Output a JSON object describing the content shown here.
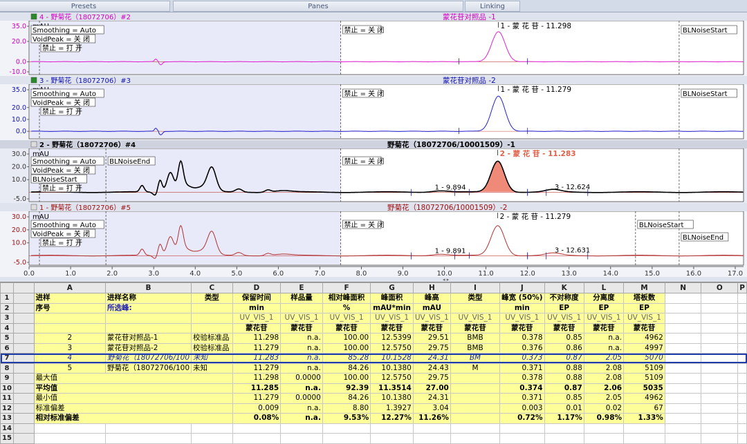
{
  "top_tabs": [
    {
      "label": "Presets"
    },
    {
      "label": "Panes"
    },
    {
      "label": "Linking"
    }
  ],
  "xaxis": {
    "min": 0,
    "max": 17.2,
    "ticks": [
      "0.0",
      "1.0",
      "2.0",
      "3.0",
      "4.0",
      "5.0",
      "6.0",
      "7.0",
      "8.0",
      "9.0",
      "10.0",
      "11.0",
      "12.0",
      "13.0",
      "14.0",
      "15.0",
      "16.0",
      "17.0"
    ]
  },
  "panels": [
    {
      "header": "4 - 野菊花（18072706）#2",
      "title": "蒙花苷对照品 -1",
      "color": "#e020d8",
      "headcolor": "#d000c0",
      "unit": "mAU",
      "yticks": [
        "35.0",
        "20.0",
        "0.0",
        "-10.0"
      ],
      "ymin": -10,
      "ymax": 35,
      "selected": false,
      "labels": [
        "Smoothing = Auto",
        "VoidPeak = 关 闭",
        "禁止 = 打 开",
        "禁止 = 关 闭",
        "BLNoiseStart"
      ],
      "peaks": [
        "1 - 蒙 花 苷 - 11.298"
      ],
      "fill": false
    },
    {
      "header": "3 - 野菊花（18072706）#3",
      "title": "蒙花苷对照品 -2",
      "color": "#2020d0",
      "headcolor": "#1010b0",
      "unit": "mAU",
      "yticks": [
        "35.0",
        "20.0",
        "10.0",
        "0.0"
      ],
      "ymin": -4,
      "ymax": 35,
      "selected": false,
      "labels": [
        "Smoothing = Auto",
        "VoidPeak = 关 闭",
        "禁止 = 打 开",
        "禁止 = 关 闭",
        "BLNoiseStart"
      ],
      "peaks": [
        "1 - 蒙 花 苷 - 11.279"
      ],
      "fill": false
    },
    {
      "header": "2 - 野菊花（18072706）#4",
      "title": "野菊花（18072706/10001509）-1",
      "color": "#000000",
      "headcolor": "#000000",
      "unit": "mAU",
      "yticks": [
        "30.0",
        "20.0",
        "10.0",
        "-5.0"
      ],
      "ymin": -5,
      "ymax": 30,
      "selected": true,
      "labels": [
        "Smoothing = Auto",
        "VoidPeak = 关 闭",
        "BLNoiseStart",
        "禁止 = 打 开",
        "BLNoiseEnd",
        "禁止 = 关 闭"
      ],
      "peaks": [
        "2 - 蒙 花 苷 - 11.283",
        "1 - 9.894",
        "3 - 12.624"
      ],
      "fill": true
    },
    {
      "header": "1 - 野菊花（18072706）#5",
      "title": "野菊花（18072706/10001509）-2",
      "color": "#b03030",
      "headcolor": "#a01010",
      "unit": "mAU",
      "yticks": [
        "30.0",
        "20.0",
        "10.0",
        "-5.0"
      ],
      "ymin": -5,
      "ymax": 30,
      "selected": false,
      "labels": [
        "Smoothing = Auto",
        "VoidPeak = 关 闭",
        "禁止 = 打 开",
        "禁止 = 关 闭",
        "BLNoiseStart",
        "BLNoiseEnd"
      ],
      "peaks": [
        "2 - 蒙 花 苷 - 11.279",
        "1 - 9.891",
        "3 - 12.631"
      ],
      "fill": false
    }
  ],
  "grid": {
    "columns": [
      "A",
      "B",
      "C",
      "D",
      "E",
      "F",
      "G",
      "H",
      "I",
      "J",
      "K",
      "L",
      "M",
      "N",
      "O",
      "P"
    ],
    "header_rows": [
      [
        "进样",
        "进样名称",
        "类型",
        "保留时间",
        "样品量",
        "相对峰面积",
        "峰面积",
        "峰高",
        "类型",
        "峰宽 (50%)",
        "不对称度",
        "分离度",
        "塔板数"
      ],
      [
        "序号",
        "所选峰:",
        "",
        "min",
        "",
        "%",
        "mAU*min",
        "mAU",
        "",
        "min",
        "EP",
        "EP",
        "EP"
      ],
      [
        "",
        "",
        "",
        "UV_VIS_1",
        "UV_VIS_1",
        "UV_VIS_1",
        "UV_VIS_1",
        "UV_VIS_1",
        "UV_VIS_1",
        "UV_VIS_1",
        "UV_VIS_1",
        "UV_VIS_1",
        "UV_VIS_1"
      ],
      [
        "",
        "",
        "",
        "蒙花苷",
        "蒙花苷",
        "蒙花苷",
        "蒙花苷",
        "蒙花苷",
        "蒙花苷",
        "蒙花苷",
        "蒙花苷",
        "蒙花苷",
        "蒙花苷"
      ]
    ],
    "data_rows": [
      [
        "2",
        "蒙花苷对照品-1",
        "校验标准品",
        "11.298",
        "n.a.",
        "100.00",
        "12.5399",
        "29.51",
        "BMB",
        "0.378",
        "0.85",
        "n.a.",
        "4962"
      ],
      [
        "3",
        "蒙花苷对照品-2",
        "校验标准品",
        "11.279",
        "n.a.",
        "100.00",
        "12.5750",
        "29.75",
        "BMB",
        "0.376",
        "0.86",
        "n.a.",
        "4997"
      ],
      [
        "4",
        "野菊花（18072706/100",
        "未知",
        "11.283",
        "n.a.",
        "85.28",
        "10.1528",
        "24.31",
        "BM",
        "0.373",
        "0.87",
        "2.05",
        "5070"
      ],
      [
        "5",
        "野菊花（18072706/100",
        "未知",
        "11.279",
        "n.a.",
        "84.26",
        "10.1380",
        "24.43",
        "M",
        "0.371",
        "0.88",
        "2.08",
        "5109"
      ]
    ],
    "stat_rows": [
      [
        "最大值",
        "11.298",
        "0.0000",
        "100.00",
        "12.5750",
        "29.75",
        "",
        "0.378",
        "0.88",
        "2.08",
        "5109"
      ],
      [
        "平均值",
        "11.285",
        "n.a.",
        "92.39",
        "11.3514",
        "27.00",
        "",
        "0.374",
        "0.87",
        "2.06",
        "5035"
      ],
      [
        "最小值",
        "11.279",
        "0.0000",
        "84.26",
        "10.1380",
        "24.31",
        "",
        "0.371",
        "0.85",
        "2.05",
        "4962"
      ],
      [
        "标准偏差",
        "0.009",
        "n.a.",
        "8.80",
        "1.3927",
        "3.04",
        "",
        "0.003",
        "0.01",
        "0.02",
        "67"
      ],
      [
        "相对标准偏差",
        "0.08%",
        "n.a.",
        "9.53%",
        "12.27%",
        "11.26%",
        "",
        "0.72%",
        "1.17%",
        "0.98%",
        "1.33%"
      ]
    ],
    "row_numbers": [
      "1",
      "2",
      "3",
      "4",
      "5",
      "6",
      "7",
      "8",
      "9",
      "10",
      "11",
      "12",
      "13",
      "14",
      "15"
    ]
  }
}
